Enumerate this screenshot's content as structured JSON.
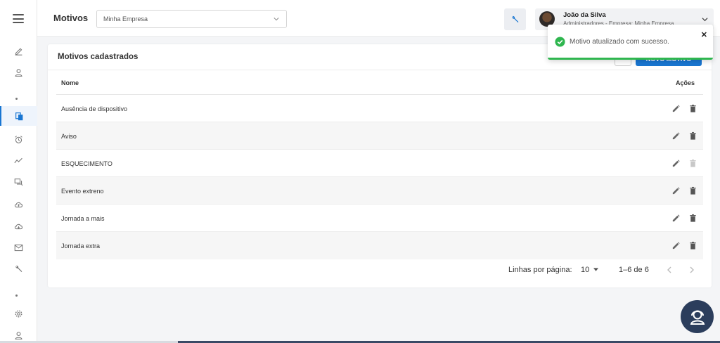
{
  "header": {
    "title": "Motivos",
    "company_select": {
      "value": "Minha Empresa"
    },
    "user": {
      "name": "João da Silva",
      "role": "Administradores - Empresa: Minha Empresa"
    }
  },
  "card": {
    "title": "Motivos cadastrados",
    "new_button_label": "NOVO MOTIVO",
    "columns": {
      "name": "Nome",
      "actions": "Ações"
    },
    "rows": [
      {
        "name": "Ausência de dispositivo",
        "delete_enabled": true
      },
      {
        "name": "Aviso",
        "delete_enabled": true
      },
      {
        "name": "ESQUECIMENTO",
        "delete_enabled": false
      },
      {
        "name": "Evento extreno",
        "delete_enabled": true
      },
      {
        "name": "Jornada a mais",
        "delete_enabled": true
      },
      {
        "name": "Jornada extra",
        "delete_enabled": true
      }
    ],
    "pagination": {
      "rows_label": "Linhas por página:",
      "rows_value": "10",
      "range": "1–6 de 6"
    }
  },
  "toast": {
    "message": "Motivo atualizado com sucesso.",
    "close": "✕"
  },
  "colors": {
    "primary": "#1976d2",
    "success": "#2fb64f",
    "support": "#2b3d5c"
  },
  "icons": {
    "sidebar": [
      "edit-icon",
      "user-icon",
      "documents-icon",
      "alarm-icon",
      "trend-icon",
      "chat-icon",
      "cloud-upload-icon",
      "cloud-download-icon",
      "mail-icon",
      "wrench-icon",
      "gear-icon",
      "user-icon"
    ]
  }
}
